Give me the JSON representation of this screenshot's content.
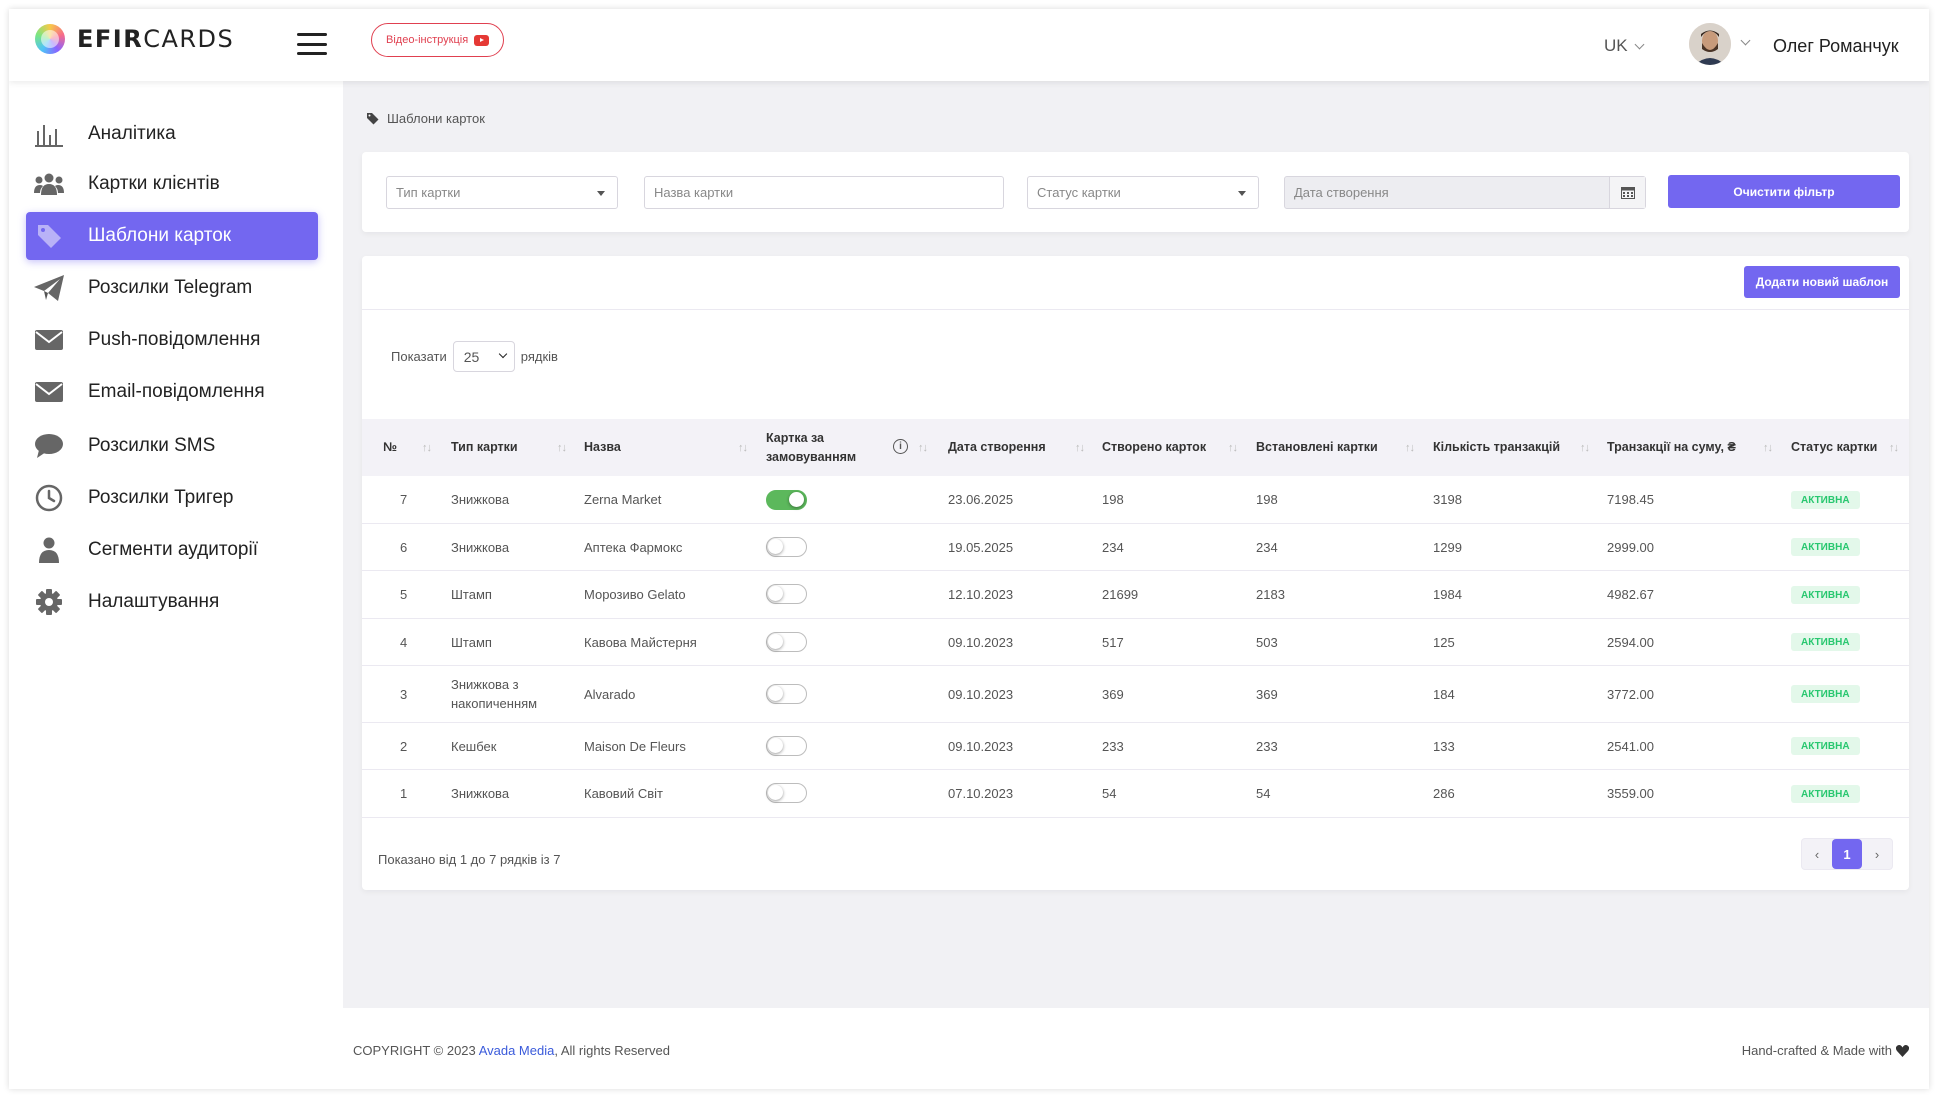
{
  "header": {
    "logo_bold": "EFIR",
    "logo_light": "CARDS",
    "video_button": "Відео-інструкція",
    "language": "UK",
    "user_name": "Олег Романчук"
  },
  "sidebar": {
    "items": [
      {
        "label": "Аналітика",
        "icon": "bar-chart-icon"
      },
      {
        "label": "Картки клієнтів",
        "icon": "users-icon"
      },
      {
        "label": "Шаблони карток",
        "icon": "tag-icon"
      },
      {
        "label": "Розсилки Telegram",
        "icon": "paper-plane-icon"
      },
      {
        "label": "Push-повідомлення",
        "icon": "envelope-icon"
      },
      {
        "label": "Email-повідомлення",
        "icon": "envelope-icon"
      },
      {
        "label": "Розсилки SMS",
        "icon": "chat-bubble-icon"
      },
      {
        "label": "Розсилки Тригер",
        "icon": "clock-icon"
      },
      {
        "label": "Сегменти аудиторії",
        "icon": "user-icon"
      },
      {
        "label": "Налаштування",
        "icon": "gear-icon"
      }
    ],
    "active_index": 2
  },
  "breadcrumb": "Шаблони карток",
  "filters": {
    "card_type_placeholder": "Тип картки",
    "card_name_placeholder": "Назва картки",
    "card_status_placeholder": "Статус картки",
    "date_placeholder": "Дата створення",
    "clear_button": "Очистити фільтр"
  },
  "table_card": {
    "add_button": "Додати новий шаблон",
    "show_label": "Показати",
    "rows_label": "рядків",
    "page_size": "25",
    "columns": [
      "№",
      "Тип картки",
      "Назва",
      "Картка за замовуванням",
      "Дата створення",
      "Створено карток",
      "Встановлені картки",
      "Кількість транзакцій",
      "Транзакції на суму, ₴",
      "Статус картки"
    ],
    "rows": [
      {
        "num": "7",
        "type": "Знижкова",
        "name": "Zerna Market",
        "default": true,
        "date": "23.06.2025",
        "created": "198",
        "installed": "198",
        "transactions": "3198",
        "sum": "7198.45",
        "status": "АКТИВНА"
      },
      {
        "num": "6",
        "type": "Знижкова",
        "name": "Аптека Фармокс",
        "default": false,
        "date": "19.05.2025",
        "created": "234",
        "installed": "234",
        "transactions": "1299",
        "sum": "2999.00",
        "status": "АКТИВНА"
      },
      {
        "num": "5",
        "type": "Штамп",
        "name": "Морозиво Gelato",
        "default": false,
        "date": "12.10.2023",
        "created": "21699",
        "installed": "2183",
        "transactions": "1984",
        "sum": "4982.67",
        "status": "АКТИВНА"
      },
      {
        "num": "4",
        "type": "Штамп",
        "name": "Кавова Майстерня",
        "default": false,
        "date": "09.10.2023",
        "created": "517",
        "installed": "503",
        "transactions": "125",
        "sum": "2594.00",
        "status": "АКТИВНА"
      },
      {
        "num": "3",
        "type": "Знижкова з накопиченням",
        "name": "Alvarado",
        "default": false,
        "date": "09.10.2023",
        "created": "369",
        "installed": "369",
        "transactions": "184",
        "sum": "3772.00",
        "status": "АКТИВНА"
      },
      {
        "num": "2",
        "type": "Кешбек",
        "name": "Maison De Fleurs",
        "default": false,
        "date": "09.10.2023",
        "created": "233",
        "installed": "233",
        "transactions": "133",
        "sum": "2541.00",
        "status": "АКТИВНА"
      },
      {
        "num": "1",
        "type": "Знижкова",
        "name": "Кавовий Світ",
        "default": false,
        "date": "07.10.2023",
        "created": "54",
        "installed": "54",
        "transactions": "286",
        "sum": "3559.00",
        "status": "АКТИВНА"
      }
    ],
    "summary": "Показано від 1 до 7 рядків із 7",
    "pagination": {
      "prev": "‹",
      "current": "1",
      "next": "›"
    }
  },
  "footer": {
    "copyright_prefix": "COPYRIGHT © 2023",
    "company": "Avada Media",
    "copyright_suffix": ", All rights Reserved",
    "made_with": "Hand-crafted & Made with"
  },
  "colors": {
    "accent": "#7367f0",
    "success": "#28c76f",
    "toggle_on": "#5cb85c",
    "video_red": "#e04050"
  }
}
